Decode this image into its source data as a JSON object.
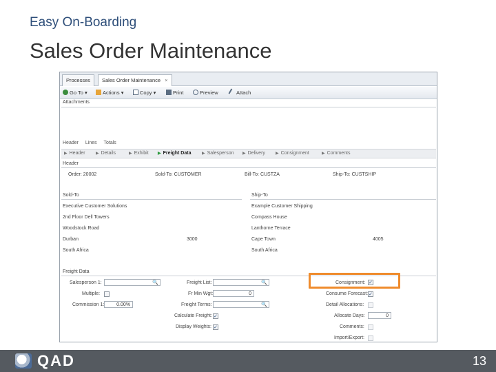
{
  "slide": {
    "kicker": "Easy On-Boarding",
    "title": "Sales Order Maintenance",
    "page_number": "13",
    "logo_text": "QAD"
  },
  "window": {
    "tabs": [
      {
        "label": "Processes",
        "active": false
      },
      {
        "label": "Sales Order Maintenance",
        "active": true
      }
    ],
    "close_glyph": "×",
    "toolbar": [
      {
        "label": "Go To",
        "icon": "go-to-icon"
      },
      {
        "label": "Actions",
        "icon": "actions-icon"
      },
      {
        "label": "Copy",
        "icon": "copy-icon"
      },
      {
        "label": "Print",
        "icon": "print-icon"
      },
      {
        "label": "Preview",
        "icon": "preview-icon"
      },
      {
        "label": "Attach",
        "icon": "attach-icon"
      }
    ],
    "attachments_label": "Attachments",
    "subtabs": [
      "Header",
      "Lines",
      "Totals"
    ],
    "flow_steps": [
      {
        "label": "Header",
        "active": false
      },
      {
        "label": "Details",
        "active": false
      },
      {
        "label": "Exhibit",
        "active": false
      },
      {
        "label": "Freight Data",
        "active": true
      },
      {
        "label": "Salesperson",
        "active": false
      },
      {
        "label": "Delivery",
        "active": false
      },
      {
        "label": "Consignment",
        "active": false
      },
      {
        "label": "Comments",
        "active": false
      }
    ]
  },
  "header_section": {
    "title": "Header",
    "order": "Order: 20002",
    "sold_to": "Sold-To: CUSTOMER",
    "bill_to": "Bill-To: CUSTZA",
    "ship_to": "Ship-To: CUSTSHIP"
  },
  "sold_to": {
    "title": "Sold-To",
    "lines": [
      "Executive Customer Solutions",
      "2nd Floor Dell Towers",
      "Woodstock Road",
      "Durban",
      "South Africa"
    ],
    "postal": "3000"
  },
  "ship_to": {
    "title": "Ship-To",
    "lines": [
      "Example Customer Shipping",
      "Compass House",
      "Lanthorne Terrace",
      "Cape Town",
      "South Africa"
    ],
    "postal": "4005"
  },
  "freight": {
    "title": "Freight Data",
    "salesperson_label": "Salesperson 1:",
    "salesperson_value": "",
    "multiple_label": "Multiple:",
    "multiple_checked": false,
    "commission_label": "Commission 1:",
    "commission_value": "0.00%",
    "freight_list_label": "Freight List:",
    "freight_list_value": "",
    "fr_min_wt_label": "Fr Min Wgt:",
    "fr_min_wt_value": "0",
    "freight_terms_label": "Freight Terms:",
    "freight_terms_value": "",
    "calc_freight_label": "Calculate Freight:",
    "calc_freight_checked": true,
    "display_weights_label": "Display Weights:",
    "display_weights_checked": true,
    "consignment_label": "Consignment:",
    "consignment_checked": true,
    "consume_forecast_label": "Consume Forecast:",
    "consume_forecast_checked": true,
    "detail_allocations_label": "Detail Allocations:",
    "detail_allocations_checked": false,
    "allocate_days_label": "Allocate Days:",
    "allocate_days_value": "0",
    "comments_label": "Comments:",
    "comments_checked": false,
    "import_export_label": "Import/Export:",
    "import_export_checked": false
  },
  "colors": {
    "highlight": "#ef8b2c",
    "footer": "#555a60",
    "kicker": "#2f4f7a"
  }
}
